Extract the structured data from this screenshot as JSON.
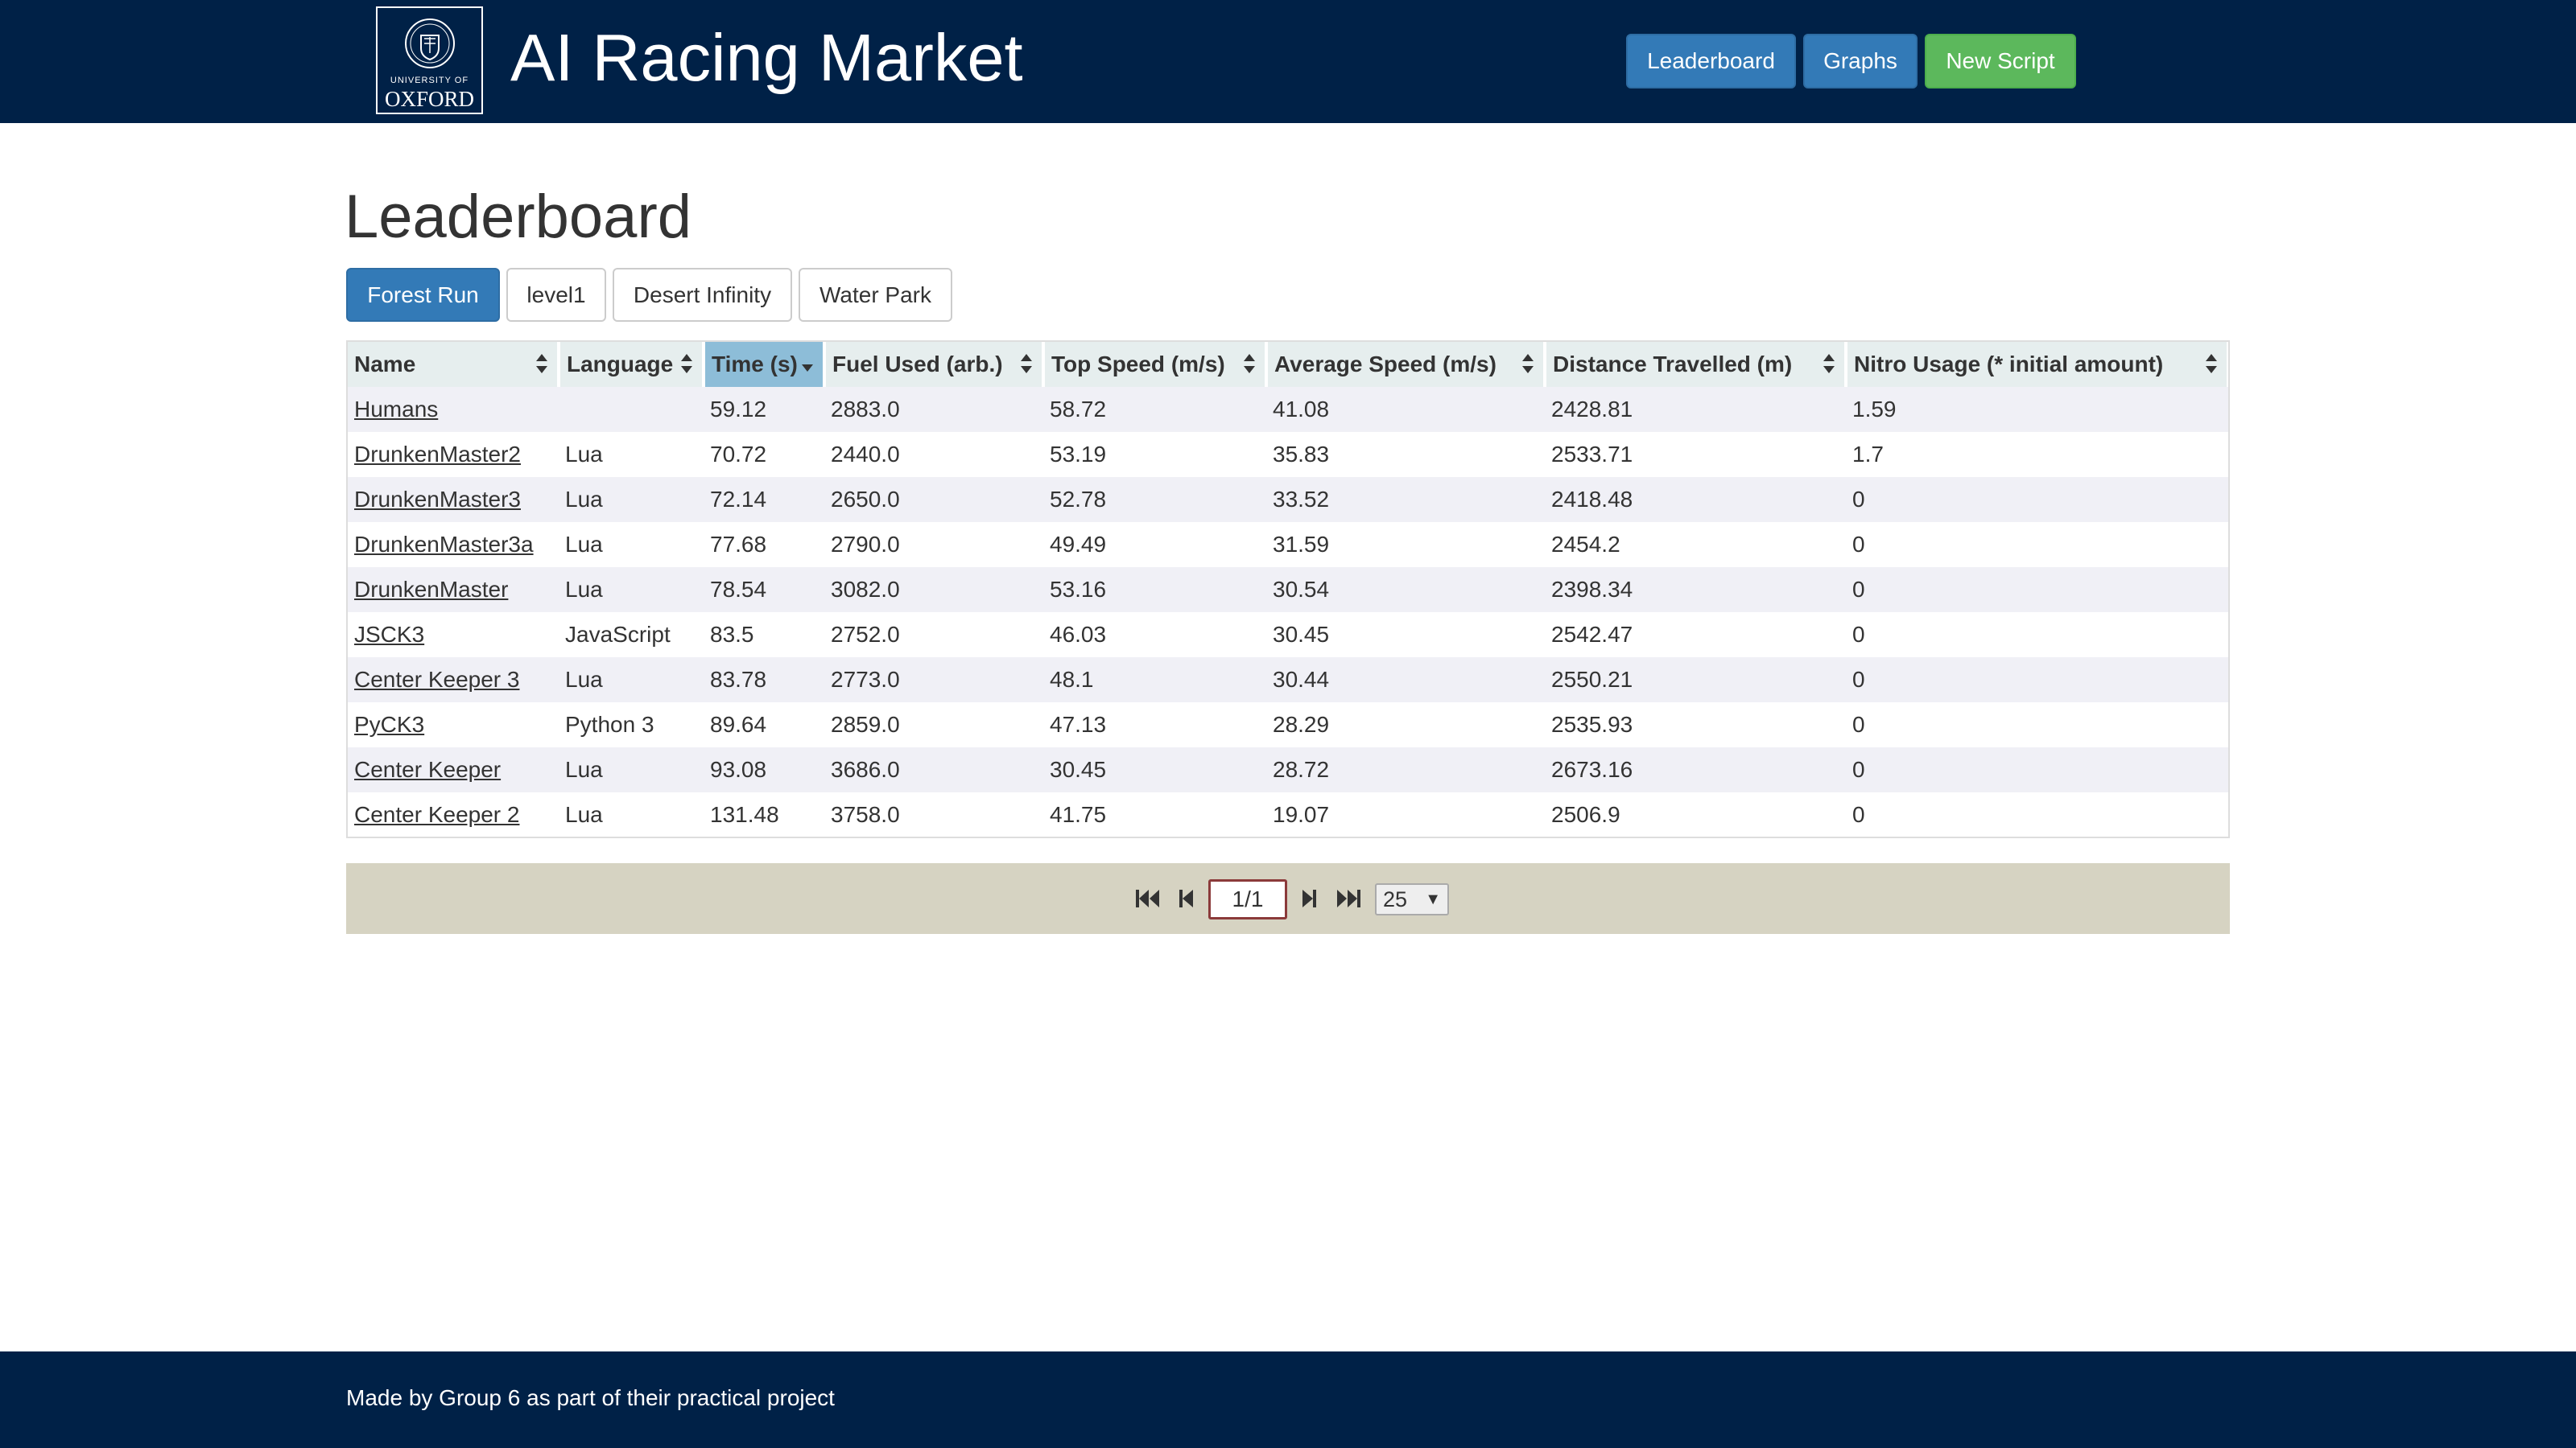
{
  "brand": {
    "logo_top": "UNIVERSITY OF",
    "logo_main": "OXFORD",
    "title": "AI Racing Market"
  },
  "nav": {
    "leaderboard": "Leaderboard",
    "graphs": "Graphs",
    "new_script": "New Script"
  },
  "page": {
    "title": "Leaderboard"
  },
  "tracks": [
    {
      "label": "Forest Run",
      "active": true
    },
    {
      "label": "level1",
      "active": false
    },
    {
      "label": "Desert Infinity",
      "active": false
    },
    {
      "label": "Water Park",
      "active": false
    }
  ],
  "table": {
    "columns": [
      {
        "label": "Name"
      },
      {
        "label": "Language"
      },
      {
        "label": "Time (s)",
        "sorted": "desc"
      },
      {
        "label": "Fuel Used (arb.)"
      },
      {
        "label": "Top Speed (m/s)"
      },
      {
        "label": "Average Speed (m/s)"
      },
      {
        "label": "Distance Travelled (m)"
      },
      {
        "label": "Nitro Usage (* initial amount)"
      }
    ],
    "rows": [
      [
        "Humans",
        "",
        "59.12",
        "2883.0",
        "58.72",
        "41.08",
        "2428.81",
        "1.59"
      ],
      [
        "DrunkenMaster2",
        "Lua",
        "70.72",
        "2440.0",
        "53.19",
        "35.83",
        "2533.71",
        "1.7"
      ],
      [
        "DrunkenMaster3",
        "Lua",
        "72.14",
        "2650.0",
        "52.78",
        "33.52",
        "2418.48",
        "0"
      ],
      [
        "DrunkenMaster3a",
        "Lua",
        "77.68",
        "2790.0",
        "49.49",
        "31.59",
        "2454.2",
        "0"
      ],
      [
        "DrunkenMaster",
        "Lua",
        "78.54",
        "3082.0",
        "53.16",
        "30.54",
        "2398.34",
        "0"
      ],
      [
        "JSCK3",
        "JavaScript",
        "83.5",
        "2752.0",
        "46.03",
        "30.45",
        "2542.47",
        "0"
      ],
      [
        "Center Keeper 3",
        "Lua",
        "83.78",
        "2773.0",
        "48.1",
        "30.44",
        "2550.21",
        "0"
      ],
      [
        "PyCK3",
        "Python 3",
        "89.64",
        "2859.0",
        "47.13",
        "28.29",
        "2535.93",
        "0"
      ],
      [
        "Center Keeper",
        "Lua",
        "93.08",
        "3686.0",
        "30.45",
        "28.72",
        "2673.16",
        "0"
      ],
      [
        "Center Keeper 2",
        "Lua",
        "131.48",
        "3758.0",
        "41.75",
        "19.07",
        "2506.9",
        "0"
      ]
    ]
  },
  "pager": {
    "page_value": "1/1",
    "page_size": "25",
    "icons": [
      "first-page-icon",
      "prev-page-icon",
      "next-page-icon",
      "last-page-icon"
    ]
  },
  "footer": {
    "text": "Made by Group 6 as part of their practical project"
  },
  "colors": {
    "navbar": "#002147",
    "primary": "#337ab7",
    "success": "#5cb85c",
    "sorted_header": "#8dbdd8",
    "pager_bg": "#d6d3c2"
  }
}
